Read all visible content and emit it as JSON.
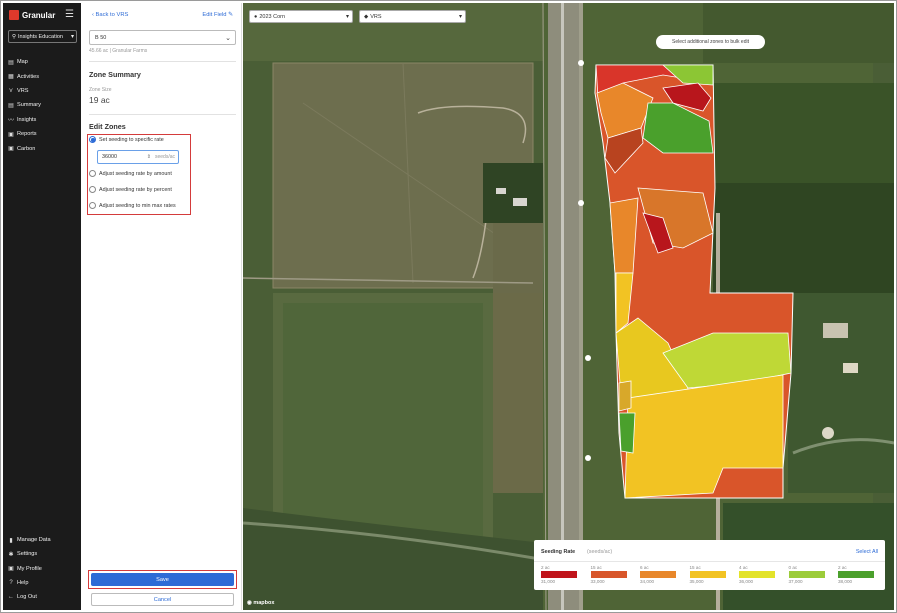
{
  "app": {
    "name": "Granular"
  },
  "sidebar": {
    "org": "Insights Education",
    "items": [
      {
        "label": "Map",
        "icon": "map-icon",
        "glyph": "▤"
      },
      {
        "label": "Activities",
        "icon": "activities-icon",
        "glyph": "▦"
      },
      {
        "label": "VRS",
        "icon": "vrs-icon",
        "glyph": "⋎"
      },
      {
        "label": "Summary",
        "icon": "summary-icon",
        "glyph": "▤"
      },
      {
        "label": "Insights",
        "icon": "insights-icon",
        "glyph": "〰"
      },
      {
        "label": "Reports",
        "icon": "reports-icon",
        "glyph": "▣"
      },
      {
        "label": "Carbon",
        "icon": "carbon-icon",
        "glyph": "▣"
      }
    ],
    "bottom": [
      {
        "label": "Manage Data",
        "icon": "manage-data-icon",
        "glyph": "▮"
      },
      {
        "label": "Settings",
        "icon": "settings-icon",
        "glyph": "✱"
      },
      {
        "label": "My Profile",
        "icon": "profile-icon",
        "glyph": "▣"
      },
      {
        "label": "Help",
        "icon": "help-icon",
        "glyph": "?"
      },
      {
        "label": "Log Out",
        "icon": "logout-icon",
        "glyph": "←"
      }
    ]
  },
  "panel": {
    "back": "Back to VRS",
    "edit_field": "Edit Field",
    "field": "B 50",
    "meta": "45.66 ac | Granular Farms",
    "zone_summary_title": "Zone Summary",
    "zone_size_label": "Zone Size",
    "zone_size_value": "19 ac",
    "edit_zones_title": "Edit Zones",
    "options": [
      "Set seeding to specific rate",
      "Adjust seeding rate by amount",
      "Adjust seeding rate by percent",
      "Adjust seeding to min max rates"
    ],
    "selected_option": 0,
    "rate_value": "36000",
    "rate_unit": "seeds/ac",
    "save": "Save",
    "cancel": "Cancel"
  },
  "map": {
    "season_select": "2023 Corn",
    "layer_select": "VRS",
    "hint": "Select additional zones to bulk edit",
    "attribution": "mapbox"
  },
  "legend": {
    "title": "Seeding Rate",
    "unit": "(seeds/ac)",
    "select_all": "Select All",
    "items": [
      {
        "acres": "2 ac",
        "rate": "31,000",
        "color": "#c0141b"
      },
      {
        "acres": "15 ac",
        "rate": "33,000",
        "color": "#d8562a"
      },
      {
        "acres": "6 ac",
        "rate": "34,000",
        "color": "#e8872a"
      },
      {
        "acres": "15 ac",
        "rate": "35,000",
        "color": "#f2c323"
      },
      {
        "acres": "4 ac",
        "rate": "36,000",
        "color": "#e3e32a"
      },
      {
        "acres": "0 ac",
        "rate": "37,000",
        "color": "#9ccc3a"
      },
      {
        "acres": "2 ac",
        "rate": "38,000",
        "color": "#4ba02c"
      }
    ]
  }
}
